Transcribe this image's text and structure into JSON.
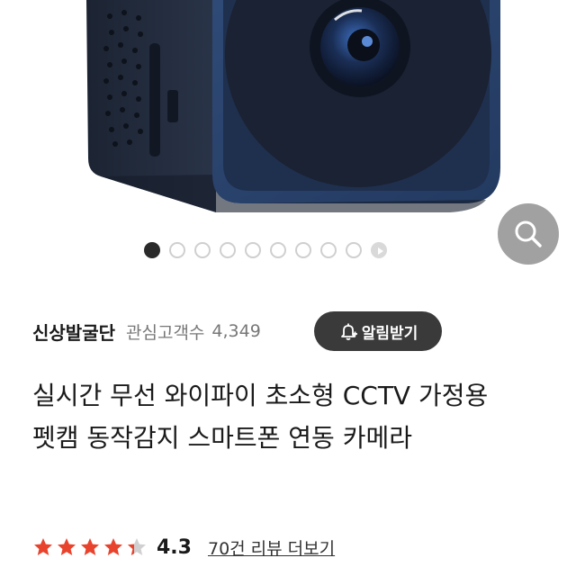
{
  "product_image": {
    "alt": "",
    "icon": "mini-camera-product-photo"
  },
  "carousel": {
    "total": 10,
    "active_index": 0,
    "last_is_video": true
  },
  "zoom_button": {
    "icon": "search-icon"
  },
  "seller": {
    "name": "신상발굴단",
    "followers_label": "관심고객수",
    "followers_count": "4,349",
    "alert_button_label": "알림받기",
    "alert_icon": "bell-plus-icon"
  },
  "product": {
    "title": "실시간 무선 와이파이 초소형 CCTV 가정용 펫캠 동작감지 스마트폰 연동 카메라"
  },
  "rating": {
    "value": "4.3",
    "stars": 4.3,
    "review_link": "70건 리뷰 더보기"
  },
  "colors": {
    "star": "#e8432d",
    "star_empty": "#d0d0d0",
    "camera_body": "#2a3f63",
    "button_dark": "#3a3a3a"
  }
}
